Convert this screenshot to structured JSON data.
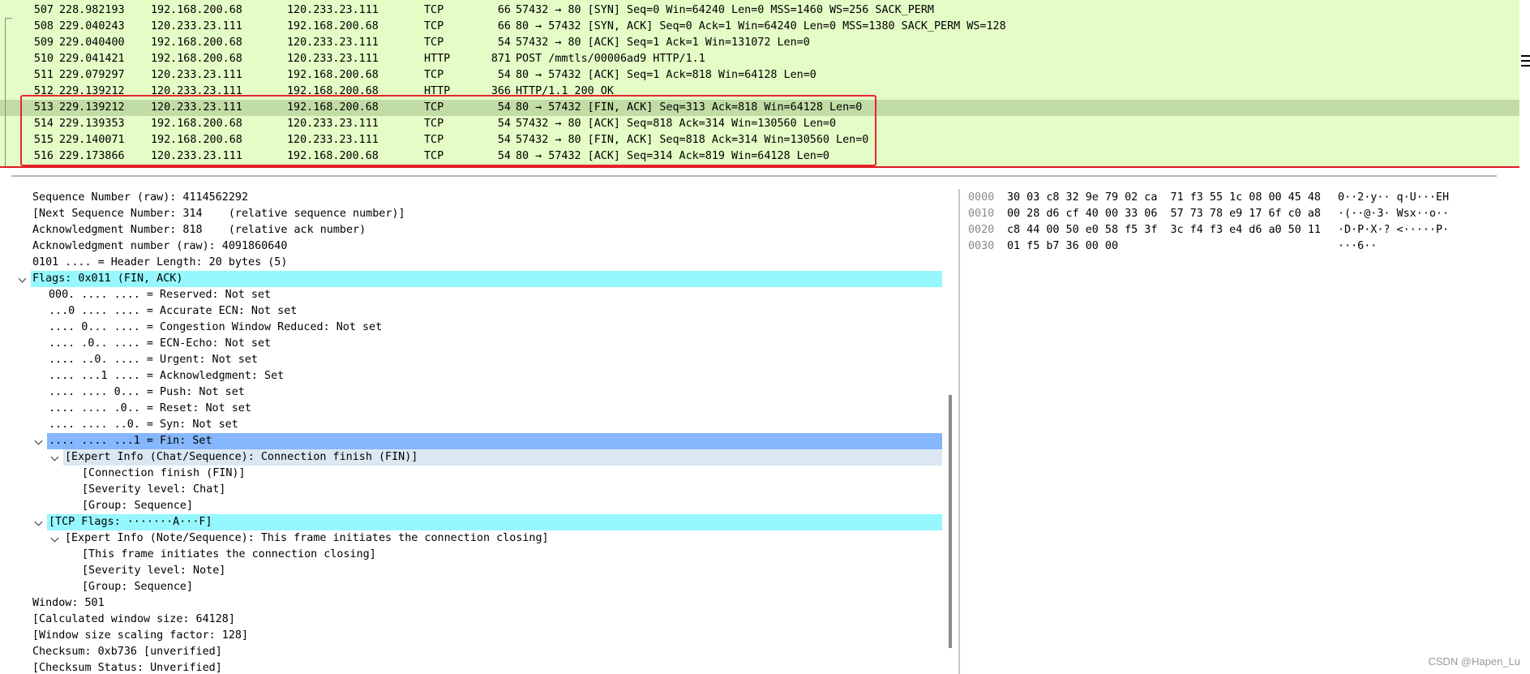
{
  "packets": [
    {
      "no": "507",
      "time": "228.982193",
      "src": "192.168.200.68",
      "dst": "120.233.23.111",
      "proto": "TCP",
      "len": "66",
      "info": "57432 → 80 [SYN] Seq=0 Win=64240 Len=0 MSS=1460 WS=256 SACK_PERM"
    },
    {
      "no": "508",
      "time": "229.040243",
      "src": "120.233.23.111",
      "dst": "192.168.200.68",
      "proto": "TCP",
      "len": "66",
      "info": "80 → 57432 [SYN, ACK] Seq=0 Ack=1 Win=64240 Len=0 MSS=1380 SACK_PERM WS=128"
    },
    {
      "no": "509",
      "time": "229.040400",
      "src": "192.168.200.68",
      "dst": "120.233.23.111",
      "proto": "TCP",
      "len": "54",
      "info": "57432 → 80 [ACK] Seq=1 Ack=1 Win=131072 Len=0"
    },
    {
      "no": "510",
      "time": "229.041421",
      "src": "192.168.200.68",
      "dst": "120.233.23.111",
      "proto": "HTTP",
      "len": "871",
      "info": "POST /mmtls/00006ad9 HTTP/1.1"
    },
    {
      "no": "511",
      "time": "229.079297",
      "src": "120.233.23.111",
      "dst": "192.168.200.68",
      "proto": "TCP",
      "len": "54",
      "info": "80 → 57432 [ACK] Seq=1 Ack=818 Win=64128 Len=0"
    },
    {
      "no": "512",
      "time": "229.139212",
      "src": "120.233.23.111",
      "dst": "192.168.200.68",
      "proto": "HTTP",
      "len": "366",
      "info": "HTTP/1.1 200 OK"
    },
    {
      "no": "513",
      "time": "229.139212",
      "src": "120.233.23.111",
      "dst": "192.168.200.68",
      "proto": "TCP",
      "len": "54",
      "info": "80 → 57432 [FIN, ACK] Seq=313 Ack=818 Win=64128 Len=0",
      "selected": true
    },
    {
      "no": "514",
      "time": "229.139353",
      "src": "192.168.200.68",
      "dst": "120.233.23.111",
      "proto": "TCP",
      "len": "54",
      "info": "57432 → 80 [ACK] Seq=818 Ack=314 Win=130560 Len=0"
    },
    {
      "no": "515",
      "time": "229.140071",
      "src": "192.168.200.68",
      "dst": "120.233.23.111",
      "proto": "TCP",
      "len": "54",
      "info": "57432 → 80 [FIN, ACK] Seq=818 Ack=314 Win=130560 Len=0"
    },
    {
      "no": "516",
      "time": "229.173866",
      "src": "120.233.23.111",
      "dst": "192.168.200.68",
      "proto": "TCP",
      "len": "54",
      "info": "80 → 57432 [ACK] Seq=314 Ack=819 Win=64128 Len=0"
    }
  ],
  "details": [
    {
      "text": "Sequence Number (raw): 4114562292",
      "level": 0
    },
    {
      "text": "[Next Sequence Number: 314    (relative sequence number)]",
      "level": 0
    },
    {
      "text": "Acknowledgment Number: 818    (relative ack number)",
      "level": 0
    },
    {
      "text": "Acknowledgment number (raw): 4091860640",
      "level": 0
    },
    {
      "text": "0101 .... = Header Length: 20 bytes (5)",
      "level": 0
    },
    {
      "text": "Flags: 0x011 (FIN, ACK)",
      "level": 0,
      "expand": true,
      "hl": "cyan"
    },
    {
      "text": "000. .... .... = Reserved: Not set",
      "level": 1
    },
    {
      "text": "...0 .... .... = Accurate ECN: Not set",
      "level": 1
    },
    {
      "text": ".... 0... .... = Congestion Window Reduced: Not set",
      "level": 1
    },
    {
      "text": ".... .0.. .... = ECN-Echo: Not set",
      "level": 1
    },
    {
      "text": ".... ..0. .... = Urgent: Not set",
      "level": 1
    },
    {
      "text": ".... ...1 .... = Acknowledgment: Set",
      "level": 1
    },
    {
      "text": ".... .... 0... = Push: Not set",
      "level": 1
    },
    {
      "text": ".... .... .0.. = Reset: Not set",
      "level": 1
    },
    {
      "text": ".... .... ..0. = Syn: Not set",
      "level": 1
    },
    {
      "text": ".... .... ...1 = Fin: Set",
      "level": 1,
      "expand": true,
      "hl": "blue"
    },
    {
      "text": "[Expert Info (Chat/Sequence): Connection finish (FIN)]",
      "level": 2,
      "expand": true,
      "hl": "grey"
    },
    {
      "text": "[Connection finish (FIN)]",
      "level": 3
    },
    {
      "text": "[Severity level: Chat]",
      "level": 3
    },
    {
      "text": "[Group: Sequence]",
      "level": 3
    },
    {
      "text": "[TCP Flags: ·······A···F]",
      "level": 1,
      "expand": true,
      "hl": "cyan"
    },
    {
      "text": "[Expert Info (Note/Sequence): This frame initiates the connection closing]",
      "level": 2,
      "expand": true
    },
    {
      "text": "[This frame initiates the connection closing]",
      "level": 3
    },
    {
      "text": "[Severity level: Note]",
      "level": 3
    },
    {
      "text": "[Group: Sequence]",
      "level": 3
    },
    {
      "text": "Window: 501",
      "level": 0
    },
    {
      "text": "[Calculated window size: 64128]",
      "level": 0
    },
    {
      "text": "[Window size scaling factor: 128]",
      "level": 0
    },
    {
      "text": "Checksum: 0xb736 [unverified]",
      "level": 0
    },
    {
      "text": "[Checksum Status: Unverified]",
      "level": 0
    }
  ],
  "bytes": [
    {
      "offset": "0000",
      "hex": "30 03 c8 32 9e 79 02 ca  71 f3 55 1c 08 00 45 48",
      "ascii": "0··2·y·· q·U···EH"
    },
    {
      "offset": "0010",
      "hex": "00 28 d6 cf 40 00 33 06  57 73 78 e9 17 6f c0 a8",
      "ascii": "·(··@·3· Wsx··o··"
    },
    {
      "offset": "0020",
      "hex": "c8 44 00 50 e0 58 f5 3f  3c f4 f3 e4 d6 a0 50 11",
      "ascii": "·D·P·X·? <·····P·"
    },
    {
      "offset": "0030",
      "hex": "01 f5 b7 36 00 00",
      "ascii": "···6··"
    }
  ],
  "watermark": "CSDN @Hapen_Lu",
  "colors": {
    "packet_bg": "#e4fcc6",
    "selected_row": "#c2dca6",
    "highlight_cyan": "#96f8fe",
    "highlight_blue": "#86b6fb",
    "red_box": "#e8252b"
  }
}
